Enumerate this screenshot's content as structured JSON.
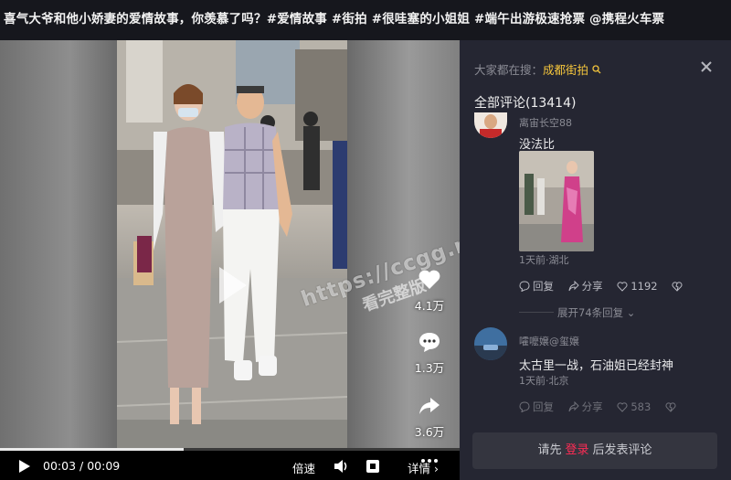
{
  "video": {
    "title": "喜气大爷和他小娇妻的爱情故事，你羡慕了吗？#爱情故事 #街拍 #很哇塞的小姐姐 #端午出游极速抢票 @携程火车票",
    "watermark_url": "https://ccgg.mobi",
    "watermark_sub": "看完整版",
    "progress_fraction": 0.4,
    "current_time": "00:03",
    "time_sep": "/",
    "duration": "00:09",
    "actions": {
      "likes": "4.1万",
      "comments": "1.3万",
      "shares": "3.6万"
    },
    "controls": {
      "speed_label": "倍速",
      "detail_label": "详情"
    }
  },
  "panel": {
    "search_prefix": "大家都在搜：",
    "search_keyword": "成都街拍",
    "comments_heading": "全部评论(13414)",
    "comments": [
      {
        "username": "离宙长空88",
        "text": "没法比",
        "meta": "1天前·湖北",
        "reply_label": "回复",
        "share_label": "分享",
        "likes": "1192"
      },
      {
        "username": "嚯嚒嬢@玺嬢",
        "text": "太古里一战，石油姐已经封神",
        "meta": "1天前·北京",
        "reply_label": "回复",
        "share_label": "分享",
        "likes": "583"
      }
    ],
    "expand_label": "展开74条回复",
    "login": {
      "prefix": "请先",
      "link": "登录",
      "suffix": "后发表评论"
    }
  },
  "colors": {
    "accent_keyword": "#f4c53c",
    "login_link": "#fe2c55",
    "panel_bg": "#252632"
  }
}
